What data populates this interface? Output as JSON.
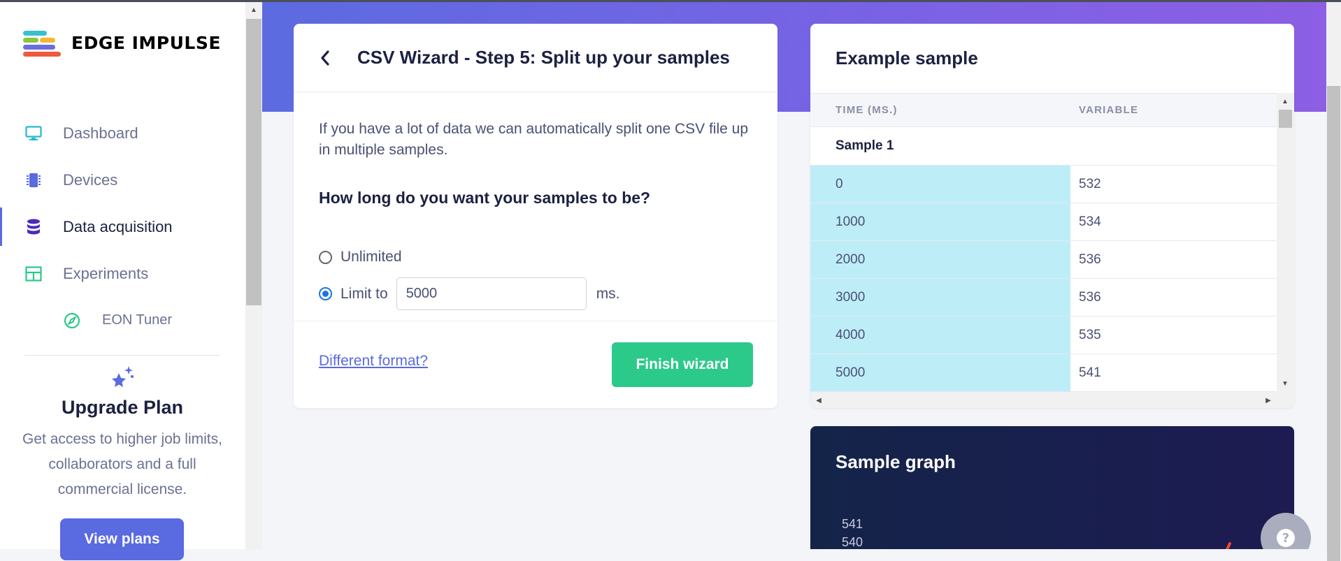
{
  "brand": {
    "name": "EDGE IMPULSE",
    "colors": {
      "accent": "#5a6ae0",
      "success": "#2bc98a",
      "highlight": "#bdeef8"
    }
  },
  "sidebar": {
    "items": [
      {
        "label": "Dashboard",
        "icon": "monitor-icon"
      },
      {
        "label": "Devices",
        "icon": "chip-icon"
      },
      {
        "label": "Data acquisition",
        "icon": "database-icon",
        "active": true
      },
      {
        "label": "Experiments",
        "icon": "grid-icon"
      },
      {
        "label": "EON Tuner",
        "icon": "compass-icon"
      }
    ],
    "upgrade": {
      "title": "Upgrade Plan",
      "text": "Get access to higher job limits, collaborators and a full commercial license.",
      "button": "View plans"
    }
  },
  "wizard": {
    "title": "CSV Wizard - Step 5: Split up your samples",
    "description": "If you have a lot of data we can automatically split one CSV file up in multiple samples.",
    "question": "How long do you want your samples to be?",
    "option_unlimited": "Unlimited",
    "option_limit": "Limit to",
    "limit_value": "5000",
    "unit": "ms.",
    "selected": "limit",
    "link": "Different format?",
    "finish": "Finish wizard"
  },
  "example": {
    "title": "Example sample",
    "columns": [
      "TIME (MS.)",
      "VARIABLE"
    ],
    "group": "Sample 1",
    "rows": [
      [
        "0",
        "532"
      ],
      [
        "1000",
        "534"
      ],
      [
        "2000",
        "536"
      ],
      [
        "3000",
        "536"
      ],
      [
        "4000",
        "535"
      ],
      [
        "5000",
        "541"
      ]
    ]
  },
  "graph": {
    "title": "Sample graph",
    "y_ticks": [
      "541",
      "540"
    ]
  }
}
